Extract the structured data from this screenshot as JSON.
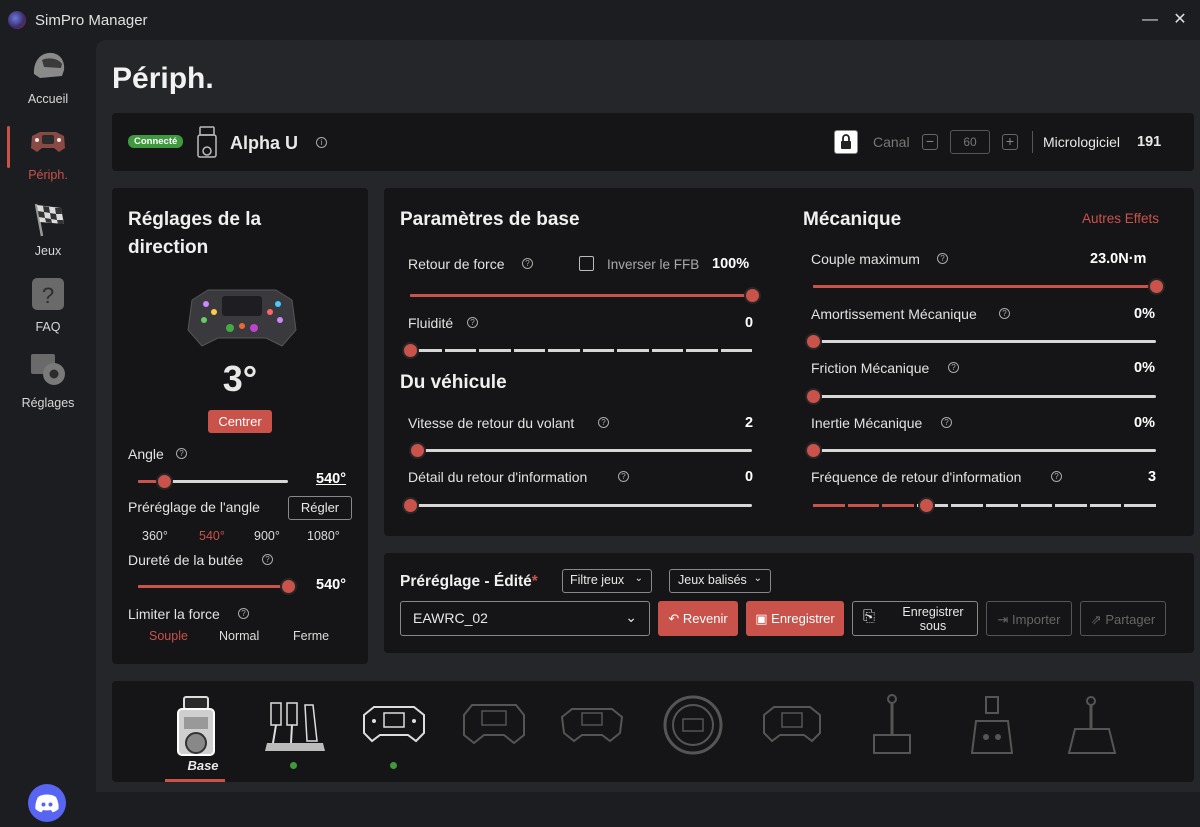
{
  "app": {
    "title": "SimPro Manager"
  },
  "window": {
    "minimize": "—",
    "close": "✕"
  },
  "sidebar": {
    "items": [
      {
        "label": "Accueil",
        "icon": "helmet-icon"
      },
      {
        "label": "Périph.",
        "icon": "wheel-icon",
        "active": true
      },
      {
        "label": "Jeux",
        "icon": "checkered-flag-icon"
      },
      {
        "label": "FAQ",
        "icon": "question-icon"
      },
      {
        "label": "Réglages",
        "icon": "gear-icon"
      }
    ],
    "discord_icon": "discord-icon"
  },
  "page": {
    "title": "Périph."
  },
  "device": {
    "status": "Connecté",
    "name": "Alpha U",
    "canal_label": "Canal",
    "canal_value": "60",
    "firmware_label": "Micrologiciel",
    "firmware_value": "191"
  },
  "steering": {
    "title": "Réglages de la direction",
    "angle_display": "3°",
    "center_label": "Centrer",
    "angle_label": "Angle",
    "angle_value": "540°",
    "angle_fraction": 0.17,
    "preset_label": "Préréglage de l'angle",
    "preset_button": "Régler",
    "presets": [
      "360°",
      "540°",
      "900°",
      "1080°"
    ],
    "selected_preset": "540°",
    "stop_label": "Dureté de la butée",
    "stop_value": "540°",
    "stop_fraction": 1.0,
    "limit_label": "Limiter la force",
    "limit_options": [
      "Souple",
      "Normal",
      "Ferme"
    ],
    "limit_selected": "Souple"
  },
  "base": {
    "title": "Paramètres de base",
    "force_label": "Retour de force",
    "invert_label": "Inverser le FFB",
    "force_value": "100%",
    "force_fraction": 1.0,
    "smooth_label": "Fluidité",
    "smooth_value": "0",
    "smooth_fraction": 0
  },
  "vehicle": {
    "title": "Du véhicule",
    "return_label": "Vitesse de retour du volant",
    "return_value": "2",
    "return_fraction": 0.02,
    "detail_label": "Détail du retour d'information",
    "detail_value": "0",
    "detail_fraction": 0
  },
  "mechanics": {
    "title": "Mécanique",
    "other_effects": "Autres Effets",
    "torque_label": "Couple maximum",
    "torque_value": "23.0N·m",
    "torque_fraction": 1.0,
    "damping_label": "Amortissement Mécanique",
    "damping_value": "0%",
    "friction_label": "Friction Mécanique",
    "friction_value": "0%",
    "inertia_label": "Inertie Mécanique",
    "inertia_value": "0%",
    "freq_label": "Fréquence de retour d'information",
    "freq_value": "3",
    "freq_fraction": 0.33
  },
  "preset": {
    "title": "Préréglage - Édité",
    "asterisk": "*",
    "filter_games": "Filtre jeux",
    "tagged_games": "Jeux balisés",
    "current": "EAWRC_02",
    "revert": "Revenir",
    "save": "Enregistrer",
    "save_as": "Enregistrer sous",
    "import": "Importer",
    "share": "Partager"
  },
  "devices_bar": {
    "selected_label": "Base",
    "items": [
      "base-icon",
      "pedals-icon",
      "wheel-rim-icon",
      "formula-wheel-icon",
      "gt-wheel-icon",
      "round-wheel-icon",
      "wheel-rim-2-icon",
      "handbrake-icon",
      "sequential-shifter-icon",
      "h-shifter-icon"
    ]
  },
  "colors": {
    "accent": "#c9524a",
    "connected": "#3f9a3f",
    "panel": "#151517",
    "bg": "#25262a"
  }
}
